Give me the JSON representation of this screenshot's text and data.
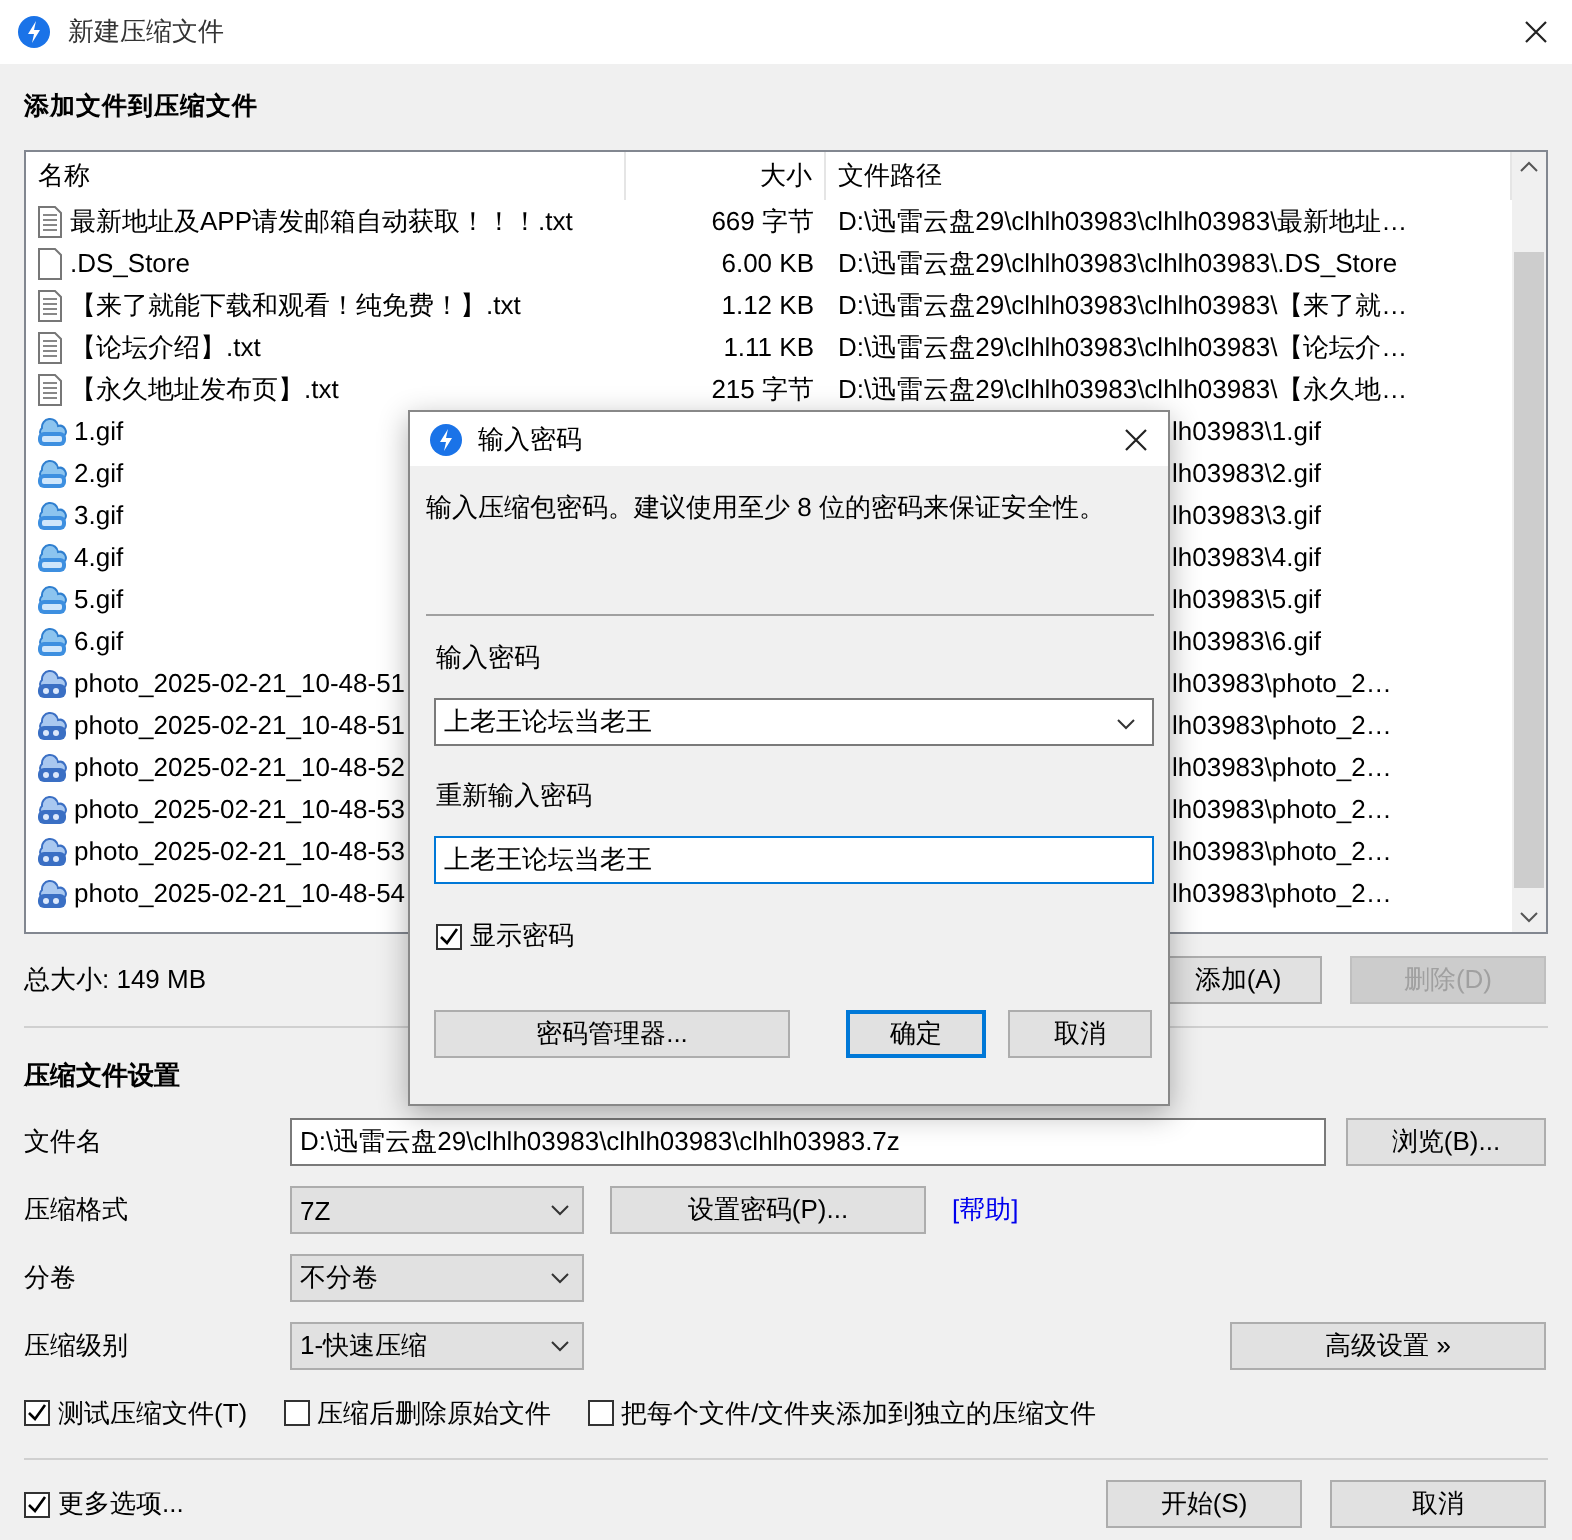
{
  "window": {
    "title": "新建压缩文件"
  },
  "add_section": {
    "heading": "添加文件到压缩文件"
  },
  "file_list": {
    "columns": [
      "名称",
      "大小",
      "文件路径"
    ],
    "rows": [
      {
        "kind": "doc",
        "name": "最新地址及APP请发邮箱自动获取！！！.txt",
        "size": "669 字节",
        "path": "D:\\迅雷云盘29\\clhlh03983\\clhlh03983\\最新地址…",
        "covered": false
      },
      {
        "kind": "blank",
        "name": ".DS_Store",
        "size": "6.00 KB",
        "path": "D:\\迅雷云盘29\\clhlh03983\\clhlh03983\\.DS_Store",
        "covered": false
      },
      {
        "kind": "doc",
        "name": "【来了就能下载和观看！纯免费！】.txt",
        "size": "1.12 KB",
        "path": "D:\\迅雷云盘29\\clhlh03983\\clhlh03983\\【来了就…",
        "covered": false
      },
      {
        "kind": "doc",
        "name": "【论坛介绍】.txt",
        "size": "1.11 KB",
        "path": "D:\\迅雷云盘29\\clhlh03983\\clhlh03983\\【论坛介…",
        "covered": false
      },
      {
        "kind": "doc",
        "name": "【永久地址发布页】.txt",
        "size": "215 字节",
        "path": "D:\\迅雷云盘29\\clhlh03983\\clhlh03983\\【永久地…",
        "covered": false
      },
      {
        "kind": "gif",
        "name": "1.gif",
        "path": "lh03983\\1.gif",
        "covered": true
      },
      {
        "kind": "gif",
        "name": "2.gif",
        "path": "lh03983\\2.gif",
        "covered": true
      },
      {
        "kind": "gif",
        "name": "3.gif",
        "path": "lh03983\\3.gif",
        "covered": true
      },
      {
        "kind": "gif",
        "name": "4.gif",
        "path": "lh03983\\4.gif",
        "covered": true
      },
      {
        "kind": "gif",
        "name": "5.gif",
        "path": "lh03983\\5.gif",
        "covered": true
      },
      {
        "kind": "gif",
        "name": "6.gif",
        "path": "lh03983\\6.gif",
        "covered": true
      },
      {
        "kind": "jpg",
        "name": "photo_2025-02-21_10-48-51",
        "path": "lh03983\\photo_2…",
        "covered": true
      },
      {
        "kind": "jpg",
        "name": "photo_2025-02-21_10-48-51",
        "path": "lh03983\\photo_2…",
        "covered": true
      },
      {
        "kind": "jpg",
        "name": "photo_2025-02-21_10-48-52",
        "path": "lh03983\\photo_2…",
        "covered": true
      },
      {
        "kind": "jpg",
        "name": "photo_2025-02-21_10-48-53",
        "path": "lh03983\\photo_2…",
        "covered": true
      },
      {
        "kind": "jpg",
        "name": "photo_2025-02-21_10-48-53",
        "path": "lh03983\\photo_2…",
        "covered": true
      },
      {
        "kind": "jpg",
        "name": "photo_2025-02-21_10-48-54",
        "path": "lh03983\\photo_2…",
        "covered": true
      }
    ]
  },
  "total_size": "总大小: 149 MB",
  "list_buttons": [
    {
      "label": "添加(A)",
      "disabled": false
    },
    {
      "label": "删除(D)",
      "disabled": true
    }
  ],
  "settings": {
    "heading": "压缩文件设置",
    "filename_label": "文件名",
    "filename": "D:\\迅雷云盘29\\clhlh03983\\clhlh03983\\clhlh03983.7z",
    "browse": "浏览(B)...",
    "format_label": "压缩格式",
    "format": "7Z",
    "set_password": "设置密码(P)...",
    "help_link": "[帮助]",
    "volume_label": "分卷",
    "volume": "不分卷",
    "level_label": "压缩级别",
    "level_value": "1-快速压缩",
    "advanced": "高级设置 »"
  },
  "options": [
    {
      "label": "测试压缩文件(T)",
      "checked": true
    },
    {
      "label": "压缩后删除原始文件",
      "checked": false
    },
    {
      "label": "把每个文件/文件夹添加到独立的压缩文件",
      "checked": false
    }
  ],
  "footer": {
    "more": {
      "label": "更多选项...",
      "checked": true
    },
    "buttons": [
      {
        "label": "开始(S)",
        "default": false
      },
      {
        "label": "取消",
        "default": false
      }
    ]
  },
  "dialog": {
    "title": "输入密码",
    "message": "输入压缩包密码。建议使用至少 8 位的密码来保证安全性。",
    "password_label": "输入密码",
    "password": "上老王论坛当老王",
    "confirm_label": "重新输入密码",
    "confirm": "上老王论坛当老王",
    "show_password": {
      "label": "显示密码",
      "checked": true
    },
    "buttons": [
      {
        "label": "密码管理器...",
        "default": false
      },
      {
        "label": "确定",
        "default": true
      },
      {
        "label": "取消",
        "default": false
      }
    ]
  }
}
